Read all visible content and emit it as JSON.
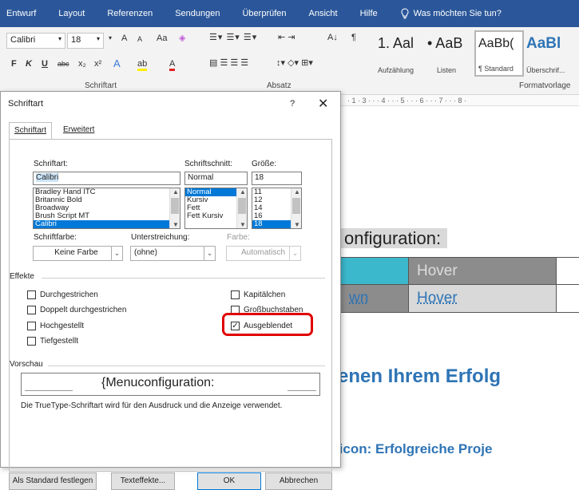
{
  "ribbon_tabs": [
    "Entwurf",
    "Layout",
    "Referenzen",
    "Sendungen",
    "Überprüfen",
    "Ansicht",
    "Hilfe"
  ],
  "tell_me": "Was möchten Sie tun?",
  "ribbon": {
    "font_name": "Calibri",
    "font_size": "18",
    "bold": "F",
    "italic": "K",
    "underline": "U",
    "strike": "abc",
    "subscript": "x₂",
    "superscript": "x²",
    "grow": "A",
    "shrink": "A",
    "change_case": "Aa",
    "text_effects": "A",
    "highlight": "ab",
    "font_color": "A",
    "sort": "A↓",
    "pilcrow": "¶",
    "group_font": "Schriftart",
    "group_paragraph": "Absatz",
    "group_styles": "Formatvorlage",
    "styles": [
      {
        "preview": "1. Aal",
        "caption": "Aufzählung"
      },
      {
        "preview": "• AaB",
        "caption": "Listen"
      },
      {
        "preview": "AaBb(",
        "caption": "¶ Standard"
      },
      {
        "preview": "AaBl",
        "caption": "Überschrif..."
      }
    ]
  },
  "ruler_text": "· 1 · 3 · · · 4 · · · 5 · · · 6 · · · 7 · · · 8 ·",
  "document": {
    "title_fragment": "onfiguration:",
    "row1": [
      "",
      "Hover"
    ],
    "row2": [
      "wn",
      "Hover"
    ],
    "heading1": "enen Ihrem Erfolg",
    "heading2": "ticon: Erfolgreiche Proje"
  },
  "dialog": {
    "title": "Schriftart",
    "help": "?",
    "close": "✕",
    "tabs": [
      "Schriftart",
      "Erweitert"
    ],
    "font_label": "Schriftart:",
    "font_value": "Calibri",
    "font_list": [
      "Bradley Hand ITC",
      "Britannic Bold",
      "Broadway",
      "Brush Script MT",
      "Calibri"
    ],
    "style_label": "Schriftschnitt:",
    "style_value": "Normal",
    "style_list": [
      "Normal",
      "Kursiv",
      "Fett",
      "Fett Kursiv"
    ],
    "size_label": "Größe:",
    "size_value": "18",
    "size_list": [
      "11",
      "12",
      "14",
      "16",
      "18"
    ],
    "color_label": "Schriftfarbe:",
    "color_value": "Keine Farbe",
    "underline_label": "Unterstreichung:",
    "underline_value": "(ohne)",
    "ucolor_label": "Farbe:",
    "ucolor_value": "Automatisch",
    "effects_label": "Effekte",
    "effects_left": [
      {
        "label": "Durchgestrichen",
        "checked": false
      },
      {
        "label": "Doppelt durchgestrichen",
        "checked": false
      },
      {
        "label": "Hochgestellt",
        "checked": false
      },
      {
        "label": "Tiefgestellt",
        "checked": false
      }
    ],
    "effects_right": [
      {
        "label": "Kapitälchen",
        "checked": false
      },
      {
        "label": "Großbuchstaben",
        "checked": false
      },
      {
        "label": "Ausgeblendet",
        "checked": true
      }
    ],
    "preview_label": "Vorschau",
    "preview_text": "{Menuconfiguration:",
    "info_text": "Die TrueType-Schriftart wird für den Ausdruck und die Anzeige verwendet.",
    "buttons": {
      "default": "Als Standard festlegen",
      "effects": "Texteffekte...",
      "ok": "OK",
      "cancel": "Abbrechen"
    }
  },
  "colors": {
    "ribbon_blue": "#2b579a",
    "selection_blue": "#0078d7",
    "heading_blue": "#2e74b5",
    "highlight_red": "#e00000",
    "table_cyan": "#3cb8cc",
    "table_gray": "#8c8c8c"
  }
}
